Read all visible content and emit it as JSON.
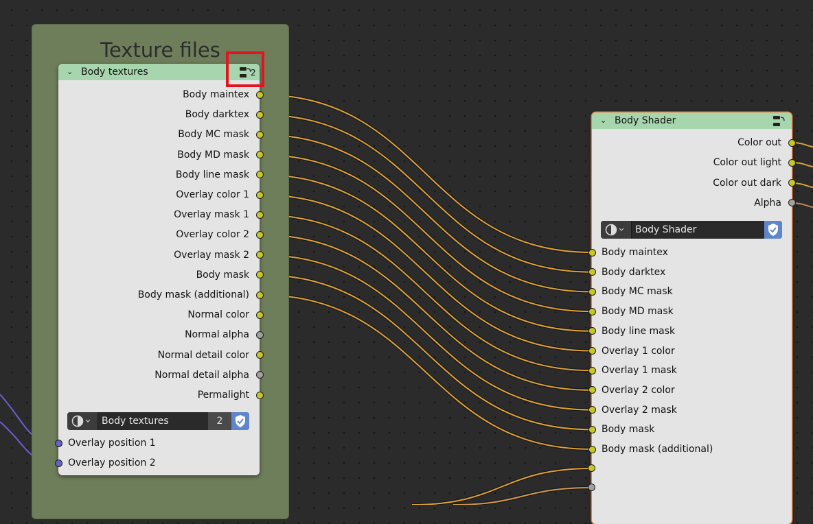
{
  "frame": {
    "title": "Texture files"
  },
  "body_textures": {
    "title": "Body textures",
    "user_count": "2",
    "outputs": [
      {
        "label": "Body maintex",
        "type": "color"
      },
      {
        "label": "Body darktex",
        "type": "color"
      },
      {
        "label": "Body MC mask",
        "type": "color"
      },
      {
        "label": "Body MD mask",
        "type": "color"
      },
      {
        "label": "Body line mask",
        "type": "color"
      },
      {
        "label": "Overlay color 1",
        "type": "color"
      },
      {
        "label": "Overlay mask 1",
        "type": "color"
      },
      {
        "label": "Overlay color 2",
        "type": "color"
      },
      {
        "label": "Overlay mask 2",
        "type": "color"
      },
      {
        "label": "Body mask",
        "type": "color"
      },
      {
        "label": "Body mask (additional)",
        "type": "color"
      },
      {
        "label": "Normal color",
        "type": "color"
      },
      {
        "label": "Normal alpha",
        "type": "value"
      },
      {
        "label": "Normal detail color",
        "type": "color"
      },
      {
        "label": "Normal detail alpha",
        "type": "value"
      },
      {
        "label": "Permalight",
        "type": "color"
      }
    ],
    "selector": {
      "name": "Body textures",
      "count": "2"
    },
    "inputs": [
      {
        "label": "Overlay position 1",
        "type": "vector"
      },
      {
        "label": "Overlay position 2",
        "type": "vector"
      }
    ]
  },
  "body_shader": {
    "title": "Body Shader",
    "outputs": [
      {
        "label": "Color out",
        "type": "color"
      },
      {
        "label": "Color out light",
        "type": "color"
      },
      {
        "label": "Color out dark",
        "type": "color"
      },
      {
        "label": "Alpha",
        "type": "value"
      }
    ],
    "selector": {
      "name": "Body Shader"
    },
    "inputs": [
      {
        "label": "Body maintex",
        "type": "color"
      },
      {
        "label": "Body darktex",
        "type": "color"
      },
      {
        "label": "Body MC mask",
        "type": "color"
      },
      {
        "label": "Body MD mask",
        "type": "color"
      },
      {
        "label": "Body line mask",
        "type": "color"
      },
      {
        "label": "Overlay 1 color",
        "type": "color"
      },
      {
        "label": "Overlay 1 mask",
        "type": "color"
      },
      {
        "label": "Overlay 2 color",
        "type": "color"
      },
      {
        "label": "Overlay 2 mask",
        "type": "color"
      },
      {
        "label": "Body mask",
        "type": "color"
      },
      {
        "label": "Body mask (additional)",
        "type": "color"
      }
    ]
  },
  "colors": {
    "background": "#2b2b2b",
    "frame": "#6e7d5a",
    "node_body": "#e4e4e4",
    "group_header": "#a7d6ae",
    "socket_color": "#c7c729",
    "socket_value": "#a1a1a1",
    "socket_vector": "#6363c7",
    "link_color": "#e0a23a",
    "link_vector": "#6a5fd0",
    "selection_outline": "#ec7a3b",
    "annotation_box": "#e3141f"
  },
  "icons": {
    "node_group": "node-group-icon",
    "collapse": "chevron-down-icon",
    "material": "node-tree-icon",
    "fake_user": "shield-check-icon"
  }
}
